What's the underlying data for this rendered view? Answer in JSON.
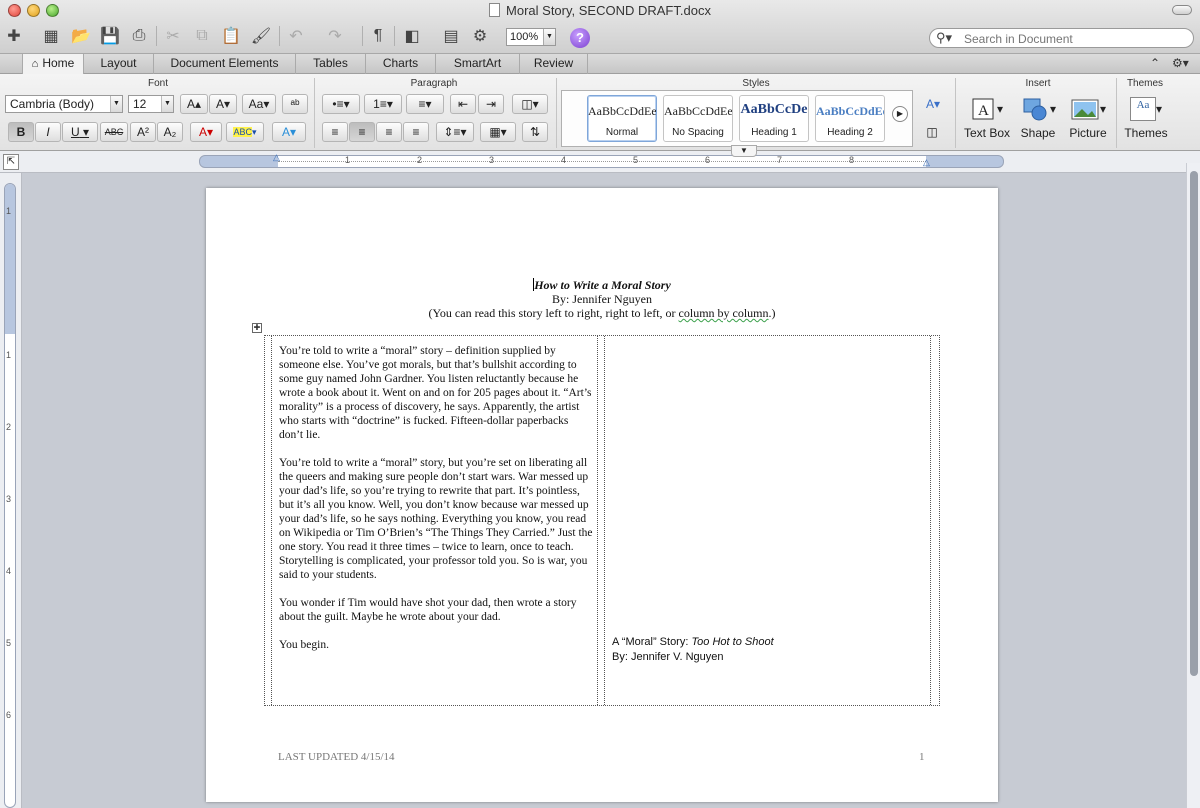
{
  "window": {
    "title": "Moral Story, SECOND DRAFT.docx"
  },
  "toolbar": {
    "zoom": "100%",
    "search_placeholder": "Search in Document"
  },
  "ribbon_tabs": [
    "Home",
    "Layout",
    "Document Elements",
    "Tables",
    "Charts",
    "SmartArt",
    "Review"
  ],
  "ribbon": {
    "groups": {
      "font": "Font",
      "paragraph": "Paragraph",
      "styles": "Styles",
      "insert": "Insert",
      "themes": "Themes"
    },
    "font_name": "Cambria (Body)",
    "font_size": "12",
    "bold": "B",
    "italic": "I",
    "underline": "U",
    "strike": "ABC",
    "superscript": "A²",
    "subscript": "A₂",
    "styles": [
      {
        "sample": "AaBbCcDdEe",
        "name": "Normal"
      },
      {
        "sample": "AaBbCcDdEe",
        "name": "No Spacing"
      },
      {
        "sample": "AaBbCcDe",
        "name": "Heading 1"
      },
      {
        "sample": "AaBbCcDdEe",
        "name": "Heading 2"
      }
    ],
    "insert": {
      "text_box": "Text Box",
      "shape": "Shape",
      "picture": "Picture"
    },
    "themes_label": "Themes",
    "themes_sample": "Aa"
  },
  "ruler": {
    "h_numbers": [
      "1",
      "2",
      "3",
      "4",
      "5",
      "6",
      "7",
      "8"
    ],
    "v_numbers": [
      "1",
      "1",
      "2",
      "3",
      "4",
      "5",
      "6"
    ]
  },
  "document": {
    "title": "How to Write a Moral Story",
    "byline": "By:  Jennifer Nguyen",
    "note_pre": "(You can read this story left to right, right to left, or ",
    "note_link": "column by column",
    "note_post": ".)",
    "left_column": [
      "You’re told to write a “moral” story – definition supplied by someone else.  You’ve got morals, but that’s bullshit according to some guy named John Gardner.  You listen reluctantly because he wrote a book about it.  Went on and on for 205 pages about it.  “Art’s morality” is a process of discovery, he says.  Apparently, the artist who starts with “doctrine” is fucked.  Fifteen-dollar paperbacks don’t lie.",
      "You’re told to write a “moral” story, but you’re set on liberating all the queers and making sure people don’t start wars.  War messed up your dad’s life, so you’re trying to rewrite that part.  It’s pointless, but it’s all you know.  Well, you don’t know because war messed up your dad’s life, so he says nothing.  Everything you know, you read on Wikipedia or Tim O’Brien’s “The Things They Carried.”  Just the one story.  You read it three times – twice to learn, once to teach.  Storytelling is complicated, your professor told you.  So is war, you said to your students.",
      "You wonder if Tim would have shot your dad, then wrote a story about the guilt.  Maybe he wrote about your dad.",
      "You begin."
    ],
    "right_credit_prefix": "A “Moral” Story:  ",
    "right_credit_title": "Too Hot to Shoot",
    "right_credit_byline": "By:  Jennifer V. Nguyen",
    "footer_left": "LAST UPDATED 4/15/14",
    "footer_right": "1"
  }
}
